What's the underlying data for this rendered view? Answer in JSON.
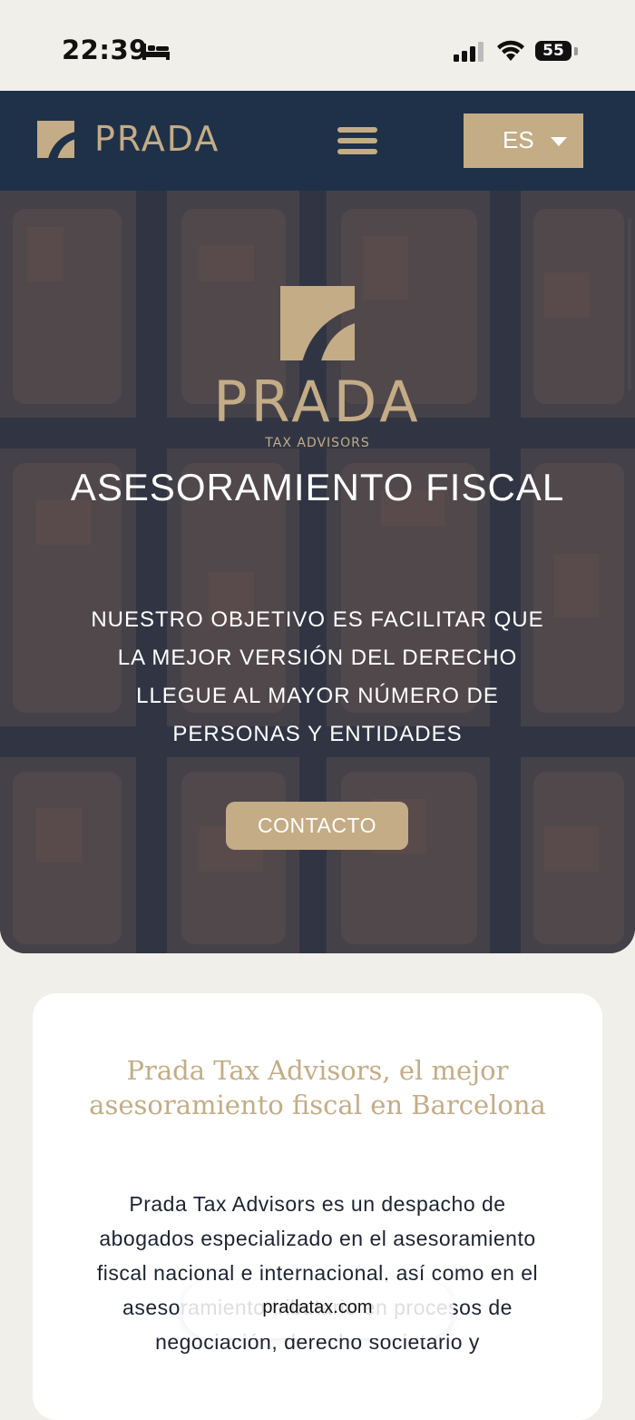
{
  "status_bar": {
    "time": "22:39",
    "battery": "55"
  },
  "nav": {
    "brand": "PRADA",
    "language": "ES"
  },
  "hero": {
    "brand": "PRADA",
    "subtitle": "TAX ADVISORS",
    "title": "ASESORAMIENTO FISCAL",
    "tagline": "NUESTRO OBJETIVO ES FACILITAR QUE LA MEJOR VERSIÓN DEL DERECHO LLEGUE AL MAYOR NÚMERO DE PERSONAS Y ENTIDADES",
    "cta": "CONTACTO"
  },
  "intro": {
    "title": "Prada Tax Advisors, el mejor asesoramiento fiscal en Barcelona",
    "text": "Prada Tax Advisors es un despacho de abogados especializado en el asesoramiento fiscal nacional e internacional, así como en el asesoramiento tributario en procesos de negociación, derecho societario y"
  },
  "browser": {
    "url": "pradatax.com"
  },
  "colors": {
    "navy": "#1f3148",
    "gold": "#c4ac86",
    "background": "#f0efea"
  }
}
